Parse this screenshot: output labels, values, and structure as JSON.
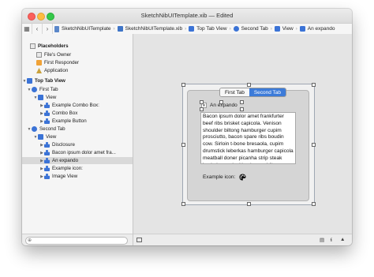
{
  "window": {
    "title": "SketchNibUITemplate.xib — Edited"
  },
  "jumpbar": {
    "crumbs": [
      "SketchNibUITemplate",
      "SketchNibUITemplate.xib",
      "Top Tab View",
      "Second Tab",
      "View",
      "An expando"
    ]
  },
  "outline": {
    "rows": [
      "Placeholders",
      "File's Owner",
      "First Responder",
      "Application",
      "Top Tab View",
      "First Tab",
      "View",
      "Example Combo Box:",
      "Combo Box",
      "Example Button",
      "Second Tab",
      "View",
      "Disclosure",
      "Bacon ipsum dolor amet fra...",
      "An expando",
      "Example icon:",
      "Image View"
    ]
  },
  "canvas": {
    "tabs": [
      "First Tab",
      "Second Tab"
    ],
    "disclosure_label": "An expando",
    "body_text": "Bacon ipsum dolor amet frankfurter beef ribs brisket capicola. Venison shoulder biltong hamburger cupim prosciutto, bacon spare ribs boudin cow. Sirloin t-bone bresaola, cupim drumstick leberkas hamburger capicola meatball doner picanha strip steak kevin bresaola. Hamburger biltong",
    "example_label": "Example icon:"
  },
  "colors": {
    "selection_tab": "#3c7bd9",
    "close": "#fc605c",
    "minimize": "#fdbc40",
    "maximize": "#34c84a"
  }
}
